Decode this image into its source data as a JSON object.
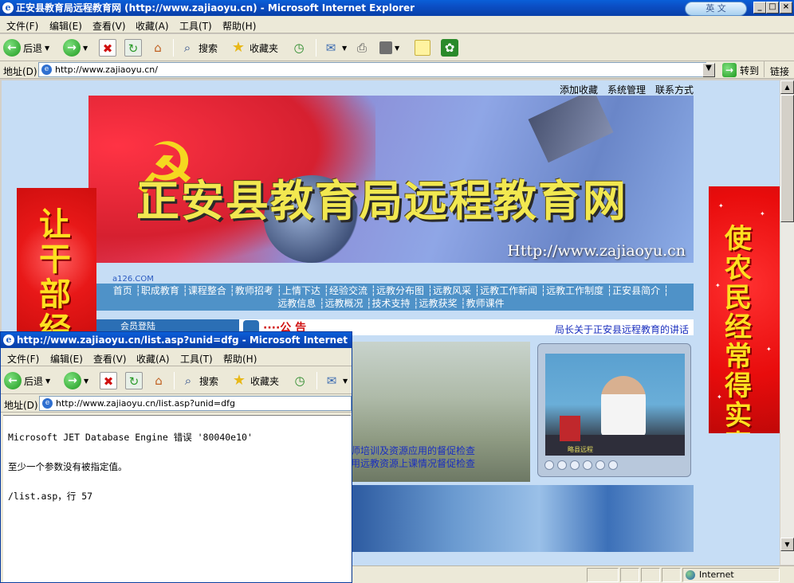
{
  "main_window": {
    "title": "正安县教育局远程教育网 (http://www.zajiaoyu.cn) - Microsoft Internet Explorer",
    "lang_button": "英 文",
    "menu": [
      "文件(F)",
      "编辑(E)",
      "查看(V)",
      "收藏(A)",
      "工具(T)",
      "帮助(H)"
    ],
    "toolbar": {
      "back": "后退",
      "search": "搜索",
      "favorites": "收藏夹"
    },
    "address_label": "地址(D)",
    "address_value": "http://www.zajiaoyu.cn/",
    "go_label": "转到",
    "links_label": "链接"
  },
  "page": {
    "top_links": [
      "添加收藏",
      "系统管理",
      "联系方式"
    ],
    "banner_title": "正安县教育局远程教育网",
    "banner_url": "Http://www.zajiaoyu.cn",
    "small_logo": "a126.COM",
    "nav_row1": "首页 ┆职成教育 ┆课程整合 ┆教师招考 ┆上情下达 ┆经验交流 ┆远教分布图 ┆远教风采 ┆远教工作新闻 ┆远教工作制度 ┆正安县简介 ┆",
    "nav_row2": "远教信息 ┆远教概况 ┆技术支持 ┆远教获奖 ┆教师课件",
    "member_label": "会员登陆",
    "notice_label": "····公  告",
    "marquee_text": "局长关于正安县远程教育的讲话",
    "photo_caption_1": "师培训及资源应用的督促检查",
    "photo_caption_2": "用远教资源上课情况督促检查",
    "player_caption": "略县远程",
    "ad_left_text": "让干部经常",
    "ad_right_text": "使农民经常得实惠"
  },
  "popup": {
    "title": "http://www.zajiaoyu.cn/list.asp?unid=dfg - Microsoft Internet Explorer",
    "menu": [
      "文件(F)",
      "编辑(E)",
      "查看(V)",
      "收藏(A)",
      "工具(T)",
      "帮助(H)"
    ],
    "toolbar": {
      "back": "后退",
      "search": "搜索",
      "favorites": "收藏夹"
    },
    "address_label": "地址(D)",
    "address_value": "http://www.zajiaoyu.cn/list.asp?unid=dfg",
    "error_line_1": "Microsoft JET Database Engine 错误 '80040e10'",
    "error_line_2": "至少一个参数没有被指定值。",
    "error_line_3": "/list.asp，行 57"
  },
  "status": {
    "zone": "Internet"
  },
  "colors": {
    "titlebar": "#0b4ec4",
    "nav": "#4f92c8",
    "page_bg": "#c6ddf5",
    "ad_red": "#e81818"
  }
}
